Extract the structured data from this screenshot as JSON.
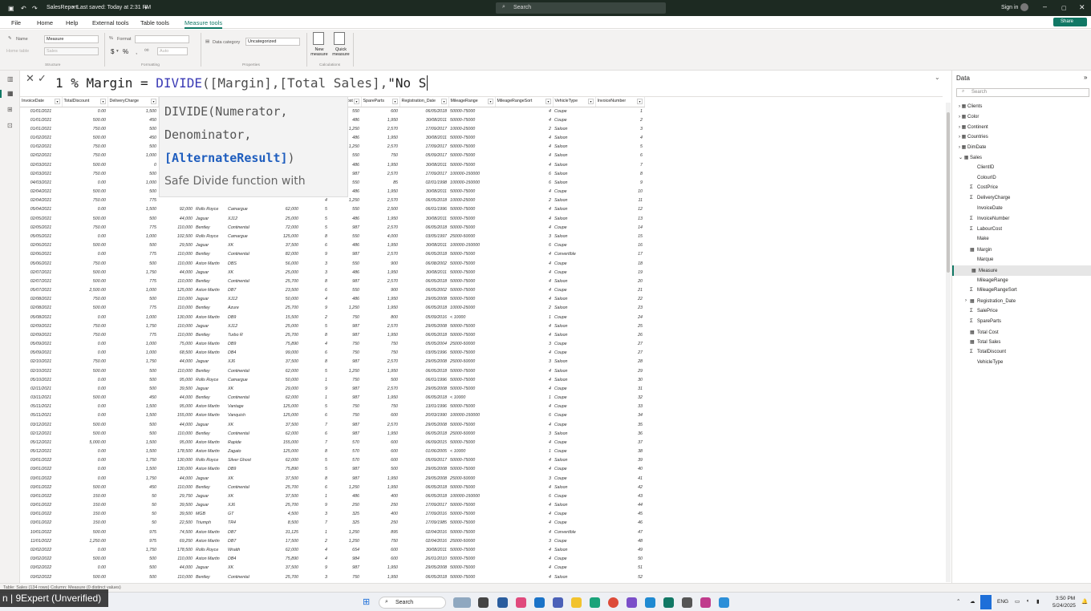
{
  "titlebar": {
    "filename": "SalesReport",
    "saved": "Last saved: Today at 2:31 PM",
    "search": "Search",
    "signin": "Sign in"
  },
  "menu": [
    "File",
    "Home",
    "Help",
    "External tools",
    "Table tools",
    "Measure tools"
  ],
  "menu_active": "Measure tools",
  "share": "Share",
  "ribbon": {
    "name_label": "Name",
    "name_value": "Measure",
    "home_table_label": "Home table",
    "home_table_value": "Sales",
    "format_label": "Format",
    "format_value": "",
    "currency": "$",
    "percent": "%",
    "comma": ",",
    "decimals_value": "Auto",
    "data_category_label": "Data category",
    "data_category_value": "Uncategorized",
    "new_measure": "New measure",
    "quick_measure": "Quick measure",
    "groups": [
      "Structure",
      "Formatting",
      "Properties",
      "Calculations"
    ]
  },
  "formula": {
    "line": "1",
    "measure": "% Margin",
    "eq": " = ",
    "fn": "DIVIDE",
    "args": "([Margin],[Total Sales],",
    "tail": "\"No S"
  },
  "tooltip": {
    "sig1": "DIVIDE(Numerator,",
    "sig2": "Denominator,",
    "sig3": "[AlternateResult]",
    "sig3b": ")",
    "desc": "Safe Divide function with"
  },
  "columns": [
    "InvoiceDate",
    "TotalDiscount",
    "DeliveryCharge",
    "SalePrice",
    "Make",
    "Marque",
    "CostPrice",
    "ClientID",
    "LabourCost",
    "SpareParts",
    "Registration_Date",
    "MileageRange",
    "MileageRangeSort",
    "VehicleType",
    "InvoiceNumber"
  ],
  "rows": [
    [
      "01/01/2021",
      "0.00",
      "1,500",
      "",
      "",
      "",
      "",
      "2",
      "550",
      "600",
      "06/05/2018",
      "50000-75000",
      "4",
      "Coupe",
      "1"
    ],
    [
      "01/01/2021",
      "500.00",
      "450",
      "",
      "",
      "",
      "",
      "6",
      "486",
      "1,950",
      "30/08/2011",
      "50000-75000",
      "4",
      "Coupe",
      "2"
    ],
    [
      "01/01/2021",
      "750.00",
      "500",
      "",
      "",
      "",
      "",
      "4",
      "1,250",
      "2,570",
      "17/09/2017",
      "10000-25000",
      "2",
      "Saloon",
      "3"
    ],
    [
      "01/02/2021",
      "500.00",
      "450",
      "",
      "",
      "",
      "",
      "8",
      "486",
      "1,950",
      "30/08/2011",
      "50000-75000",
      "4",
      "Saloon",
      "4"
    ],
    [
      "01/02/2021",
      "750.00",
      "500",
      "",
      "",
      "",
      "",
      "3",
      "1,250",
      "2,570",
      "17/09/2017",
      "50000-75000",
      "4",
      "Saloon",
      "5"
    ],
    [
      "02/02/2021",
      "750.00",
      "1,000",
      "",
      "",
      "",
      "",
      "3",
      "550",
      "750",
      "05/09/2017",
      "50000-75000",
      "4",
      "Saloon",
      "6"
    ],
    [
      "02/03/2021",
      "500.00",
      "0",
      "",
      "",
      "",
      "",
      "4",
      "486",
      "1,950",
      "30/08/2011",
      "50000-75000",
      "4",
      "Saloon",
      "7"
    ],
    [
      "02/03/2021",
      "750.00",
      "500",
      "",
      "",
      "",
      "",
      "3",
      "987",
      "2,570",
      "17/09/2017",
      "100000-150000",
      "6",
      "Saloon",
      "8"
    ],
    [
      "04/03/2021",
      "0.00",
      "1,000",
      "",
      "",
      "",
      "",
      "2",
      "550",
      "85",
      "02/01/1998",
      "100000-150000",
      "6",
      "Saloon",
      "9"
    ],
    [
      "02/04/2021",
      "500.00",
      "500",
      "",
      "",
      "",
      "",
      "6",
      "486",
      "1,950",
      "30/08/2011",
      "50000-75000",
      "4",
      "Coupe",
      "10"
    ],
    [
      "02/04/2021",
      "750.00",
      "775",
      "",
      "",
      "",
      "",
      "4",
      "1,250",
      "2,570",
      "06/05/2018",
      "10000-25000",
      "2",
      "Saloon",
      "11"
    ],
    [
      "05/04/2021",
      "0.00",
      "1,500",
      "92,000",
      "Rolls Royce",
      "Camargue",
      "62,000",
      "5",
      "550",
      "2,500",
      "06/01/1996",
      "50000-75000",
      "4",
      "Saloon",
      "12"
    ],
    [
      "02/05/2021",
      "500.00",
      "500",
      "44,000",
      "Jaguar",
      "XJ12",
      "25,000",
      "5",
      "486",
      "1,950",
      "30/08/2011",
      "50000-75000",
      "4",
      "Saloon",
      "13"
    ],
    [
      "02/05/2021",
      "750.00",
      "775",
      "110,000",
      "Bentley",
      "Continental",
      "72,000",
      "5",
      "987",
      "2,570",
      "06/05/2018",
      "50000-75000",
      "4",
      "Coupe",
      "14"
    ],
    [
      "05/05/2021",
      "0.00",
      "1,000",
      "102,500",
      "Rolls Royce",
      "Camargue",
      "125,000",
      "8",
      "550",
      "4,000",
      "03/05/1997",
      "25000-50000",
      "3",
      "Saloon",
      "15"
    ],
    [
      "02/06/2021",
      "500.00",
      "500",
      "29,500",
      "Jaguar",
      "XK",
      "37,500",
      "6",
      "486",
      "1,950",
      "30/08/2011",
      "100000-150000",
      "6",
      "Coupe",
      "16"
    ],
    [
      "02/06/2021",
      "0.00",
      "775",
      "110,000",
      "Bentley",
      "Continental",
      "82,000",
      "9",
      "987",
      "2,570",
      "06/05/2018",
      "50000-75000",
      "4",
      "Convertible",
      "17"
    ],
    [
      "05/06/2021",
      "750.00",
      "500",
      "110,000",
      "Aston Martin",
      "DBS",
      "56,000",
      "3",
      "550",
      "900",
      "06/08/2002",
      "50000-75000",
      "4",
      "Coupe",
      "18"
    ],
    [
      "02/07/2021",
      "500.00",
      "1,750",
      "44,000",
      "Jaguar",
      "XK",
      "25,000",
      "3",
      "486",
      "1,950",
      "30/08/2011",
      "50000-75000",
      "4",
      "Coupe",
      "19"
    ],
    [
      "02/07/2021",
      "500.00",
      "775",
      "110,000",
      "Bentley",
      "Continental",
      "25,700",
      "8",
      "987",
      "2,570",
      "06/05/2018",
      "50000-75000",
      "4",
      "Saloon",
      "20"
    ],
    [
      "05/07/2021",
      "2,500.00",
      "1,000",
      "125,000",
      "Aston Martin",
      "DB7",
      "23,500",
      "6",
      "550",
      "900",
      "06/05/2002",
      "50000-75000",
      "4",
      "Coupe",
      "21"
    ],
    [
      "02/08/2021",
      "750.00",
      "500",
      "110,000",
      "Jaguar",
      "XJ12",
      "50,000",
      "4",
      "486",
      "1,950",
      "29/05/2008",
      "50000-75000",
      "4",
      "Saloon",
      "22"
    ],
    [
      "02/08/2021",
      "500.00",
      "775",
      "110,000",
      "Bentley",
      "Azure",
      "25,700",
      "9",
      "1,250",
      "1,950",
      "06/05/2018",
      "10000-25000",
      "2",
      "Saloon",
      "23"
    ],
    [
      "05/08/2021",
      "0.00",
      "1,000",
      "130,000",
      "Aston Martin",
      "DB9",
      "15,500",
      "2",
      "750",
      "800",
      "05/09/2016",
      "< 10000",
      "1",
      "Coupe",
      "24"
    ],
    [
      "02/09/2021",
      "750.00",
      "1,750",
      "110,000",
      "Jaguar",
      "XJ12",
      "25,000",
      "5",
      "987",
      "2,570",
      "29/05/2008",
      "50000-75000",
      "4",
      "Saloon",
      "25"
    ],
    [
      "02/09/2021",
      "750.00",
      "775",
      "110,000",
      "Bentley",
      "Turbo R",
      "25,700",
      "8",
      "987",
      "1,950",
      "06/05/2018",
      "50000-75000",
      "4",
      "Saloon",
      "26"
    ],
    [
      "05/09/2021",
      "0.00",
      "1,000",
      "75,000",
      "Aston Martin",
      "DB9",
      "75,890",
      "4",
      "750",
      "750",
      "05/05/2004",
      "25000-50000",
      "3",
      "Coupe",
      "27"
    ],
    [
      "05/09/2021",
      "0.00",
      "1,000",
      "68,500",
      "Aston Martin",
      "DB4",
      "99,000",
      "6",
      "750",
      "750",
      "03/05/1996",
      "50000-75000",
      "4",
      "Coupe",
      "27"
    ],
    [
      "02/10/2021",
      "750.00",
      "1,750",
      "44,000",
      "Jaguar",
      "XJ6",
      "37,500",
      "8",
      "987",
      "2,570",
      "29/05/2008",
      "25000-50000",
      "3",
      "Saloon",
      "28"
    ],
    [
      "02/10/2021",
      "500.00",
      "500",
      "110,000",
      "Bentley",
      "Continental",
      "62,000",
      "5",
      "1,250",
      "1,950",
      "06/05/2018",
      "50000-75000",
      "4",
      "Saloon",
      "29"
    ],
    [
      "05/10/2021",
      "0.00",
      "500",
      "95,000",
      "Rolls Royce",
      "Camargue",
      "50,000",
      "1",
      "750",
      "500",
      "06/01/1996",
      "50000-75000",
      "4",
      "Saloon",
      "30"
    ],
    [
      "02/11/2021",
      "0.00",
      "500",
      "39,500",
      "Jaguar",
      "XK",
      "29,000",
      "9",
      "987",
      "2,570",
      "29/05/2008",
      "50000-75000",
      "4",
      "Coupe",
      "31"
    ],
    [
      "03/11/2021",
      "500.00",
      "450",
      "44,000",
      "Bentley",
      "Continental",
      "62,000",
      "1",
      "987",
      "1,950",
      "06/05/2018",
      "< 10000",
      "1",
      "Coupe",
      "32"
    ],
    [
      "05/11/2021",
      "0.00",
      "1,500",
      "95,000",
      "Aston Martin",
      "Vantage",
      "125,000",
      "5",
      "750",
      "750",
      "13/01/1996",
      "50000-75000",
      "4",
      "Coupe",
      "33"
    ],
    [
      "05/11/2021",
      "0.00",
      "1,500",
      "155,000",
      "Aston Martin",
      "Vanquish",
      "125,000",
      "6",
      "750",
      "600",
      "20/03/1990",
      "100000-150000",
      "6",
      "Coupe",
      "34"
    ],
    [
      "03/12/2021",
      "500.00",
      "500",
      "44,000",
      "Jaguar",
      "XK",
      "37,500",
      "7",
      "987",
      "2,570",
      "29/05/2008",
      "50000-75000",
      "4",
      "Coupe",
      "35"
    ],
    [
      "02/12/2021",
      "500.00",
      "500",
      "110,000",
      "Bentley",
      "Continental",
      "62,000",
      "6",
      "987",
      "1,950",
      "06/05/2018",
      "25000-50000",
      "3",
      "Saloon",
      "36"
    ],
    [
      "05/12/2021",
      "5,000.00",
      "1,500",
      "95,000",
      "Aston Martin",
      "Rapide",
      "155,000",
      "7",
      "570",
      "600",
      "06/09/2015",
      "50000-75000",
      "4",
      "Coupe",
      "37"
    ],
    [
      "05/12/2021",
      "0.00",
      "1,500",
      "178,500",
      "Aston Martin",
      "Zagato",
      "125,000",
      "8",
      "570",
      "600",
      "01/06/2005",
      "< 10000",
      "1",
      "Coupe",
      "38"
    ],
    [
      "03/01/2022",
      "0.00",
      "1,750",
      "130,000",
      "Rolls Royce",
      "Silver Ghost",
      "62,000",
      "5",
      "570",
      "600",
      "05/09/2017",
      "50000-75000",
      "4",
      "Saloon",
      "39"
    ],
    [
      "03/01/2022",
      "0.00",
      "1,500",
      "130,000",
      "Aston Martin",
      "DB9",
      "75,890",
      "5",
      "987",
      "500",
      "29/05/2008",
      "50000-75000",
      "4",
      "Coupe",
      "40"
    ],
    [
      "03/01/2022",
      "0.00",
      "1,750",
      "44,000",
      "Jaguar",
      "XK",
      "37,500",
      "8",
      "987",
      "1,950",
      "29/05/2008",
      "25000-50000",
      "3",
      "Coupe",
      "41"
    ],
    [
      "03/01/2022",
      "500.00",
      "450",
      "110,000",
      "Bentley",
      "Continental",
      "25,700",
      "6",
      "1,250",
      "1,950",
      "06/05/2018",
      "50000-75000",
      "4",
      "Saloon",
      "42"
    ],
    [
      "03/01/2022",
      "150.00",
      "50",
      "29,750",
      "Jaguar",
      "XK",
      "37,500",
      "1",
      "486",
      "400",
      "06/05/2018",
      "100000-150000",
      "6",
      "Coupe",
      "43"
    ],
    [
      "03/01/2022",
      "150.00",
      "50",
      "39,500",
      "Jaguar",
      "XJ6",
      "25,700",
      "9",
      "250",
      "250",
      "17/09/2017",
      "50000-75000",
      "4",
      "Saloon",
      "44"
    ],
    [
      "03/01/2022",
      "150.00",
      "50",
      "39,500",
      "MGB",
      "GT",
      "4,500",
      "3",
      "325",
      "400",
      "17/09/2016",
      "50000-75000",
      "4",
      "Coupe",
      "45"
    ],
    [
      "03/01/2022",
      "150.00",
      "50",
      "22,500",
      "Triumph",
      "TR4",
      "8,500",
      "7",
      "325",
      "250",
      "17/09/1985",
      "50000-75000",
      "4",
      "Coupe",
      "46"
    ],
    [
      "10/01/2022",
      "500.00",
      "975",
      "74,500",
      "Aston Martin",
      "DB7",
      "31,125",
      "1",
      "1,250",
      "895",
      "02/04/2016",
      "50000-75000",
      "4",
      "Convertible",
      "47"
    ],
    [
      "11/01/2022",
      "1,250.00",
      "975",
      "69,250",
      "Aston Martin",
      "DB7",
      "17,500",
      "2",
      "1,250",
      "750",
      "02/04/2016",
      "25000-50000",
      "3",
      "Coupe",
      "48"
    ],
    [
      "02/02/2022",
      "0.00",
      "1,750",
      "178,500",
      "Rolls Royce",
      "Wraith",
      "62,000",
      "4",
      "654",
      "600",
      "30/08/2011",
      "50000-75000",
      "4",
      "Saloon",
      "49"
    ],
    [
      "03/02/2022",
      "500.00",
      "500",
      "110,000",
      "Aston Martin",
      "DB4",
      "75,890",
      "4",
      "984",
      "600",
      "26/01/2010",
      "50000-75000",
      "4",
      "Coupe",
      "50"
    ],
    [
      "03/02/2022",
      "0.00",
      "500",
      "44,000",
      "Jaguar",
      "XK",
      "37,500",
      "9",
      "987",
      "1,950",
      "29/05/2008",
      "50000-75000",
      "4",
      "Coupe",
      "51"
    ],
    [
      "03/02/2022",
      "500.00",
      "500",
      "110,000",
      "Bentley",
      "Continental",
      "25,700",
      "3",
      "750",
      "1,950",
      "06/05/2018",
      "50000-75000",
      "4",
      "Saloon",
      "52"
    ]
  ],
  "data_pane": {
    "title": "Data",
    "search": "Search",
    "tables": [
      {
        "name": "Clients",
        "kind": "table",
        "expanded": false
      },
      {
        "name": "Color",
        "kind": "table",
        "expanded": false
      },
      {
        "name": "Continent",
        "kind": "table",
        "expanded": false
      },
      {
        "name": "Countries",
        "kind": "table",
        "expanded": false
      },
      {
        "name": "DimDate",
        "kind": "table",
        "expanded": false
      },
      {
        "name": "Sales",
        "kind": "table",
        "expanded": true
      }
    ],
    "fields": [
      {
        "name": "ClientID",
        "kind": "field"
      },
      {
        "name": "ColourID",
        "kind": "field"
      },
      {
        "name": "CostPrice",
        "kind": "sum"
      },
      {
        "name": "DeliveryCharge",
        "kind": "sum"
      },
      {
        "name": "InvoiceDate",
        "kind": "field"
      },
      {
        "name": "InvoiceNumber",
        "kind": "sum"
      },
      {
        "name": "LabourCost",
        "kind": "sum"
      },
      {
        "name": "Make",
        "kind": "field"
      },
      {
        "name": "Margin",
        "kind": "measure"
      },
      {
        "name": "Marque",
        "kind": "field"
      },
      {
        "name": "Measure",
        "kind": "measure",
        "selected": true
      },
      {
        "name": "MileageRange",
        "kind": "field"
      },
      {
        "name": "MileageRangeSort",
        "kind": "sum"
      },
      {
        "name": "Registration_Date",
        "kind": "hierarchy"
      },
      {
        "name": "SalePrice",
        "kind": "sum"
      },
      {
        "name": "SpareParts",
        "kind": "sum"
      },
      {
        "name": "Total Cost",
        "kind": "measure"
      },
      {
        "name": "Total Sales",
        "kind": "measure"
      },
      {
        "name": "TotalDiscount",
        "kind": "sum"
      },
      {
        "name": "VehicleType",
        "kind": "field"
      }
    ]
  },
  "status": "Table: Sales (134 rows) Column: Measure (0 distinct values)",
  "watermark": "n | 9Expert (Unverified)",
  "taskbar": {
    "search": "Search",
    "lang": "ENG",
    "time": "3:50 PM",
    "date": "5/24/2025"
  },
  "colors": {
    "accent": "#117865",
    "titlebar": "#1d2a22",
    "share": "#117865"
  }
}
